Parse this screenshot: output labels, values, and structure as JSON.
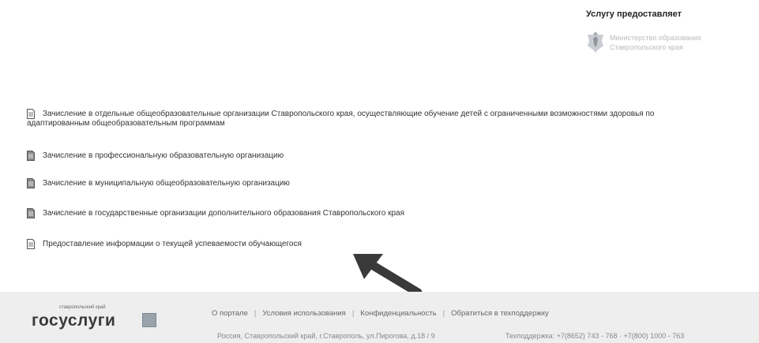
{
  "provider": {
    "title": "Услугу предоставляет",
    "name_line1": "Министерство образования",
    "name_line2": "Ставропольского края",
    "emblem_icon": "coat-of-arms-icon"
  },
  "services": [
    {
      "line1": "Зачисление в отдельные общеобразовательные организации Ставропольского края, осуществляющие обучение детей с ограниченными возможностями здоровья по",
      "line2": "адаптированным общеобразовательным программам"
    },
    {
      "line1": "Зачисление в профессиональную образовательную организацию"
    },
    {
      "line1": "Зачисление в муниципальную общеобразовательную организацию"
    },
    {
      "line1": "Зачисление в государственные организации дополнительного образования Ставропольского края"
    },
    {
      "line1": "Предоставление информации о текущей успеваемости обучающегося"
    }
  ],
  "footer": {
    "logo_small": "ставропольский край",
    "logo_big": "госуслуги",
    "links": [
      "О портале",
      "Условия использования",
      "Конфиденциальность",
      "Обратиться в техподдержку"
    ],
    "address": "Россия, Ставропольский край, г.Ставрополь, ул.Пирогова, д.18 / 9",
    "support": "Техподдержка: +7(8652) 743 - 768 · +7(800) 1000 - 763"
  },
  "colors": {
    "arrow": "#3a3a3a",
    "footer_bg": "#eeeeee"
  }
}
